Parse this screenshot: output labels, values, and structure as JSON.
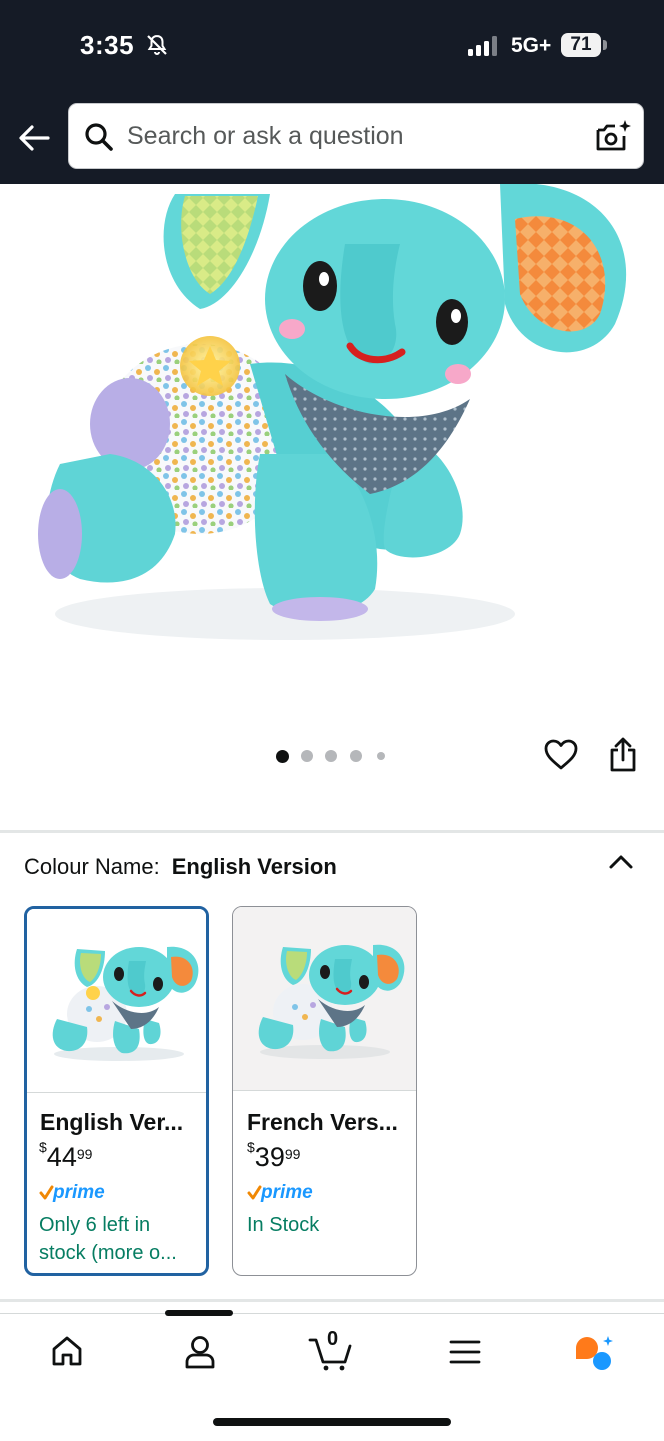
{
  "status_bar": {
    "time": "3:35",
    "network": "5G+",
    "battery": "71"
  },
  "header": {
    "search_placeholder": "Search or ask a question"
  },
  "icons": {
    "back": "back-arrow-icon",
    "search": "search-icon",
    "camera": "camera-search-icon",
    "wishlist": "heart-icon",
    "share": "share-icon",
    "collapse": "chevron-up-icon"
  },
  "gallery": {
    "image_count": 5,
    "active_index": 0
  },
  "colour_section": {
    "label": "Colour Name:",
    "selected_value": "English Version"
  },
  "variants": [
    {
      "name": "English Ver...",
      "currency": "$",
      "price_whole": "44",
      "price_cents": "99",
      "prime": "prime",
      "stock": "Only 6 left in stock (more o..."
    },
    {
      "name": "French Vers...",
      "currency": "$",
      "price_whole": "39",
      "price_cents": "99",
      "prime": "prime",
      "stock": "In Stock"
    }
  ],
  "bottom_nav": {
    "cart_count": "0",
    "items": [
      "home-icon",
      "account-icon",
      "cart-icon",
      "menu-icon",
      "rufus-assistant-icon"
    ]
  },
  "colors": {
    "header_bg": "#151b26",
    "selected_border": "#2162a1",
    "stock_green": "#067d62",
    "prime_blue": "#1a98ff",
    "prime_check": "#f08804"
  }
}
